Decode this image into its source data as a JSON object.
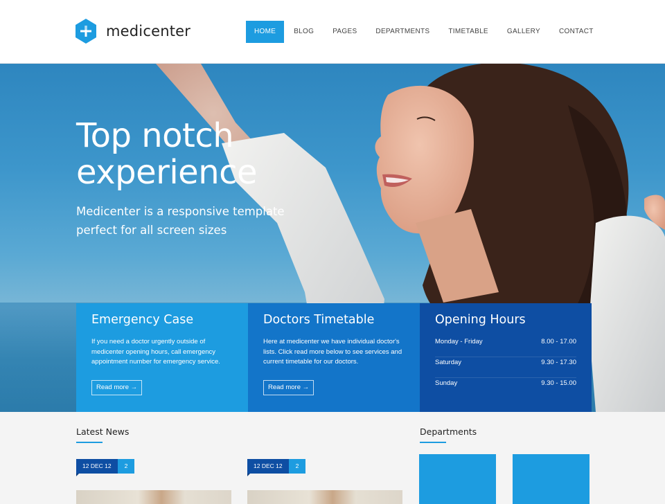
{
  "brand": {
    "name": "medicenter",
    "accent": "#1d9ce0"
  },
  "nav": {
    "items": [
      {
        "label": "HOME",
        "active": true
      },
      {
        "label": "BLOG"
      },
      {
        "label": "PAGES"
      },
      {
        "label": "DEPARTMENTS"
      },
      {
        "label": "TIMETABLE"
      },
      {
        "label": "GALLERY"
      },
      {
        "label": "CONTACT"
      }
    ]
  },
  "hero": {
    "title_line1": "Top notch",
    "title_line2": "experience",
    "subtitle_line1": "Medicenter is a responsive template",
    "subtitle_line2": "perfect for all screen sizes"
  },
  "boxes": {
    "emergency": {
      "title": "Emergency Case",
      "text": "If you need a doctor urgently outside of medicenter opening hours, call emergency appointment number for emergency service.",
      "button": "Read more →",
      "color": "#1d9ce0"
    },
    "timetable": {
      "title": "Doctors Timetable",
      "text": "Here at medicenter we have individual doctor's lists. Click read more below to see services and current timetable for our doctors.",
      "button": "Read more →",
      "color": "#1375c9"
    },
    "hours": {
      "title": "Opening Hours",
      "rows": [
        {
          "day": "Monday - Friday",
          "time": "8.00 - 17.00"
        },
        {
          "day": "Saturday",
          "time": "9.30 - 17.30"
        },
        {
          "day": "Sunday",
          "time": "9.30 - 15.00"
        }
      ],
      "color": "#0e4ea3"
    }
  },
  "latest_news": {
    "title": "Latest News",
    "posts": [
      {
        "date": "12 DEC 12",
        "comments": "2"
      },
      {
        "date": "12 DEC 12",
        "comments": "2"
      }
    ]
  },
  "departments": {
    "title": "Departments"
  }
}
